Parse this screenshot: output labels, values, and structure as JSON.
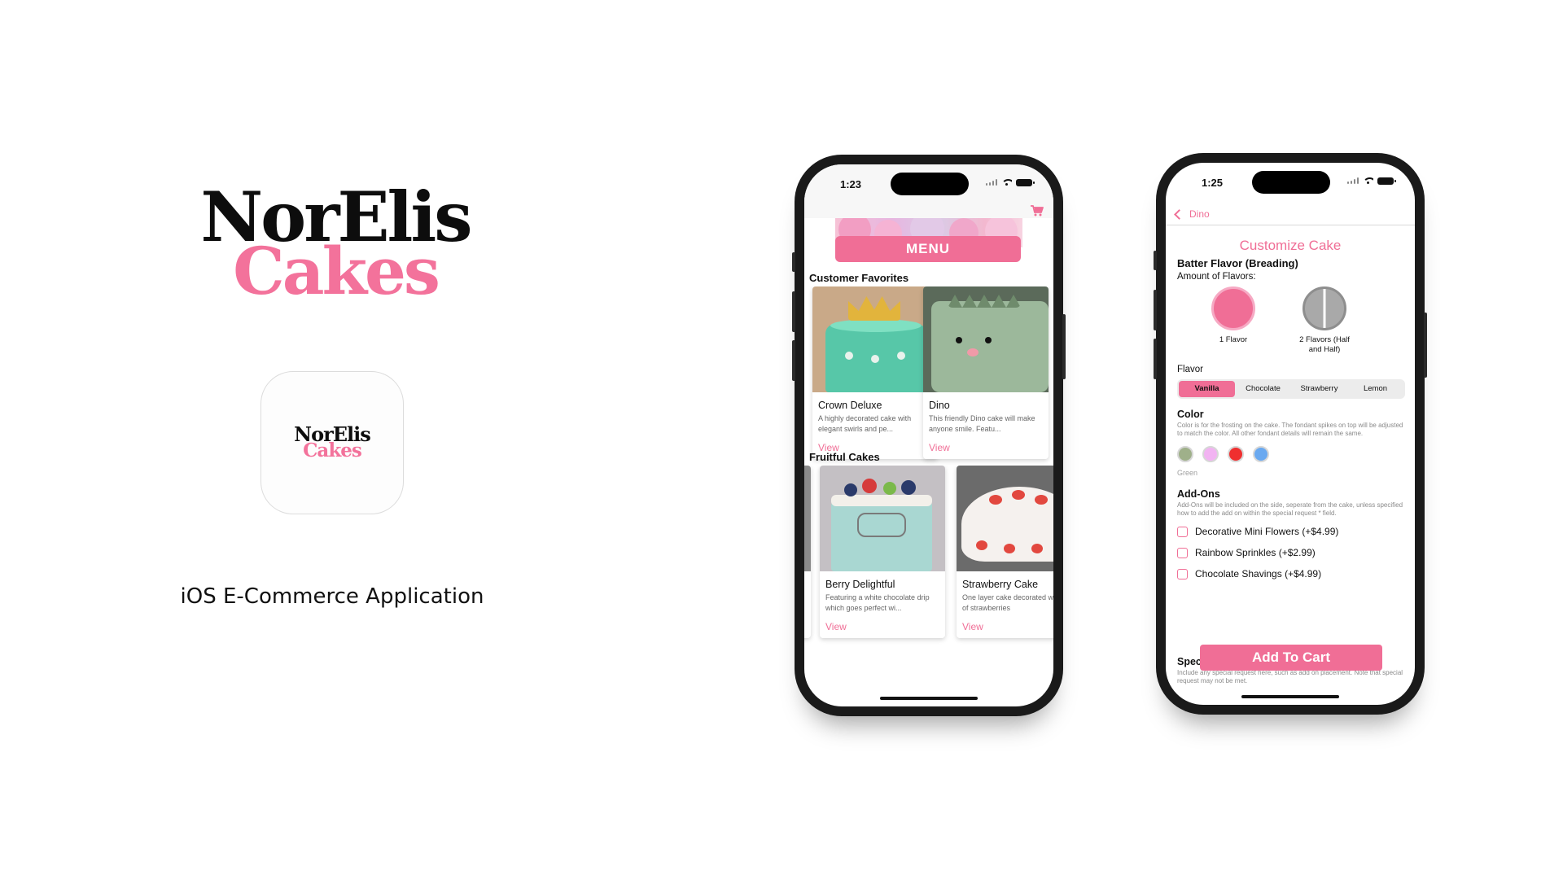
{
  "brand": {
    "logo_line1": "NorElis",
    "logo_line2": "Cakes",
    "icon_line1": "NorElis",
    "icon_line2": "Cakes",
    "tagline": "iOS E-Commerce Application"
  },
  "colors": {
    "accent_pink": "#f06e96",
    "logo_black": "#0d0d0d"
  },
  "phone1": {
    "status_time": "1:23",
    "header_icon": "cart-icon",
    "menu_label": "MENU",
    "sections": [
      {
        "title": "Customer Favorites",
        "cards": [
          {
            "title": "Crown Deluxe",
            "desc": "A highly decorated cake with elegant swirls and pe...",
            "action": "View"
          },
          {
            "title": "Dino",
            "desc": "This friendly Dino cake will make anyone smile. Featu...",
            "action": "View"
          }
        ]
      },
      {
        "title": "Fruitful Cakes",
        "cards": [
          {
            "title": "Berry Delightful",
            "desc": "Featuring a white chocolate drip which goes perfect wi...",
            "action": "View"
          },
          {
            "title": "Strawberry Cake",
            "desc": "One layer cake decorated with lots of strawberries",
            "action": "View"
          }
        ]
      }
    ]
  },
  "phone2": {
    "status_time": "1:25",
    "back_label": "Dino",
    "title": "Customize Cake",
    "batter_heading": "Batter Flavor (Breading)",
    "amount_label": "Amount of Flavors:",
    "options": [
      {
        "label": "1 Flavor"
      },
      {
        "label": "2 Flavors (Half and Half)"
      }
    ],
    "flavor_label": "Flavor",
    "flavors": [
      "Vanilla",
      "Chocolate",
      "Strawberry",
      "Lemon"
    ],
    "selected_flavor": "Vanilla",
    "color_heading": "Color",
    "color_note": "Color is for the frosting on the cake. The fondant spikes on top will be adjusted to match the color. All other fondant details will remain the same.",
    "swatches": [
      {
        "name": "Green",
        "hex": "#9fb08a"
      },
      {
        "name": "Pink",
        "hex": "#f2b3f2"
      },
      {
        "name": "Red",
        "hex": "#ef2f2f"
      },
      {
        "name": "Blue",
        "hex": "#6aa9f0"
      }
    ],
    "selected_color_name": "Green",
    "addons_heading": "Add-Ons",
    "addons_note": "Add-Ons will be included on the side, seperate from the cake, unless specified how to add the add on within the special request * field.",
    "addons": [
      "Decorative Mini Flowers (+$4.99)",
      "Rainbow Sprinkles (+$2.99)",
      "Chocolate Shavings (+$4.99)"
    ],
    "special_heading": "Spec",
    "special_note": "Include any special request here, such as add on placement. Note that special request may not be met.",
    "cart_button": "Add To Cart"
  }
}
